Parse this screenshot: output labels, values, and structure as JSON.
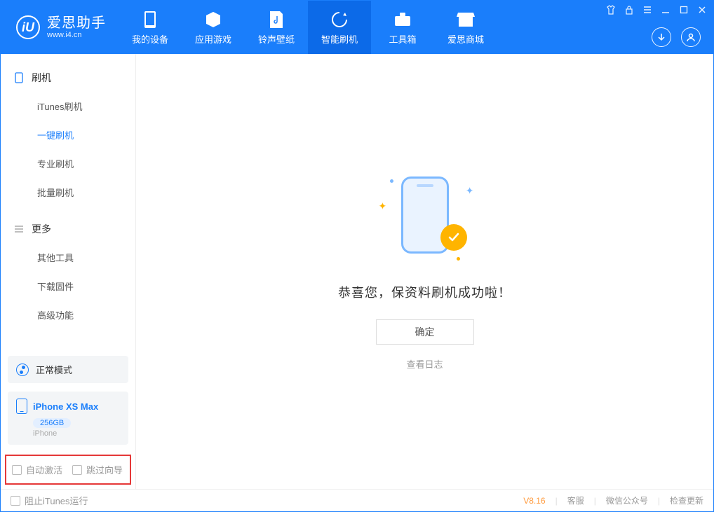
{
  "app": {
    "name": "爱思助手",
    "url": "www.i4.cn"
  },
  "nav": {
    "tabs": [
      {
        "label": "我的设备"
      },
      {
        "label": "应用游戏"
      },
      {
        "label": "铃声壁纸"
      },
      {
        "label": "智能刷机"
      },
      {
        "label": "工具箱"
      },
      {
        "label": "爱思商城"
      }
    ]
  },
  "sidebar": {
    "group1": {
      "title": "刷机",
      "items": [
        "iTunes刷机",
        "一键刷机",
        "专业刷机",
        "批量刷机"
      ]
    },
    "group2": {
      "title": "更多",
      "items": [
        "其他工具",
        "下载固件",
        "高级功能"
      ]
    },
    "mode_label": "正常模式",
    "device": {
      "name": "iPhone XS Max",
      "capacity": "256GB",
      "type": "iPhone"
    },
    "options": {
      "auto_activate": "自动激活",
      "skip_guide": "跳过向导"
    }
  },
  "main": {
    "success_message": "恭喜您，保资料刷机成功啦！",
    "ok_button": "确定",
    "view_log": "查看日志"
  },
  "statusbar": {
    "block_itunes": "阻止iTunes运行",
    "version": "V8.16",
    "links": [
      "客服",
      "微信公众号",
      "检查更新"
    ]
  }
}
